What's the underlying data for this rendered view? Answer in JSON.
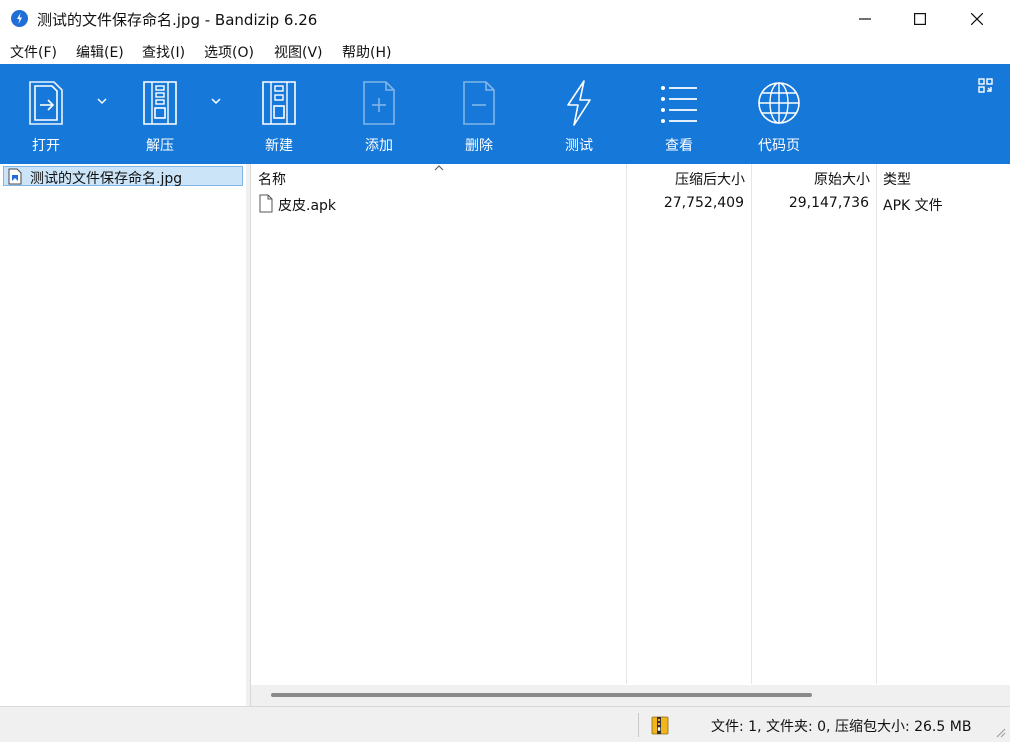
{
  "window": {
    "title": "测试的文件保存命名.jpg - Bandizip 6.26"
  },
  "menu": [
    {
      "label": "文件(F)"
    },
    {
      "label": "编辑(E)"
    },
    {
      "label": "查找(I)"
    },
    {
      "label": "选项(O)"
    },
    {
      "label": "视图(V)"
    },
    {
      "label": "帮助(H)"
    }
  ],
  "toolbar": {
    "open": "打开",
    "extract": "解压",
    "new": "新建",
    "add": "添加",
    "delete": "删除",
    "test": "测试",
    "view": "查看",
    "codepage": "代码页"
  },
  "tree": {
    "item": "测试的文件保存命名.jpg"
  },
  "columns": {
    "name": "名称",
    "compressed": "压缩后大小",
    "original": "原始大小",
    "type": "类型"
  },
  "files": [
    {
      "name": "皮皮.apk",
      "compressed": "27,752,409",
      "original": "29,147,736",
      "type": "APK 文件"
    }
  ],
  "status": {
    "text": "文件: 1, 文件夹: 0, 压缩包大小: 26.5 MB"
  },
  "colors": {
    "toolbar_bg": "#1678d8",
    "selection_bg": "#cce4f7"
  }
}
